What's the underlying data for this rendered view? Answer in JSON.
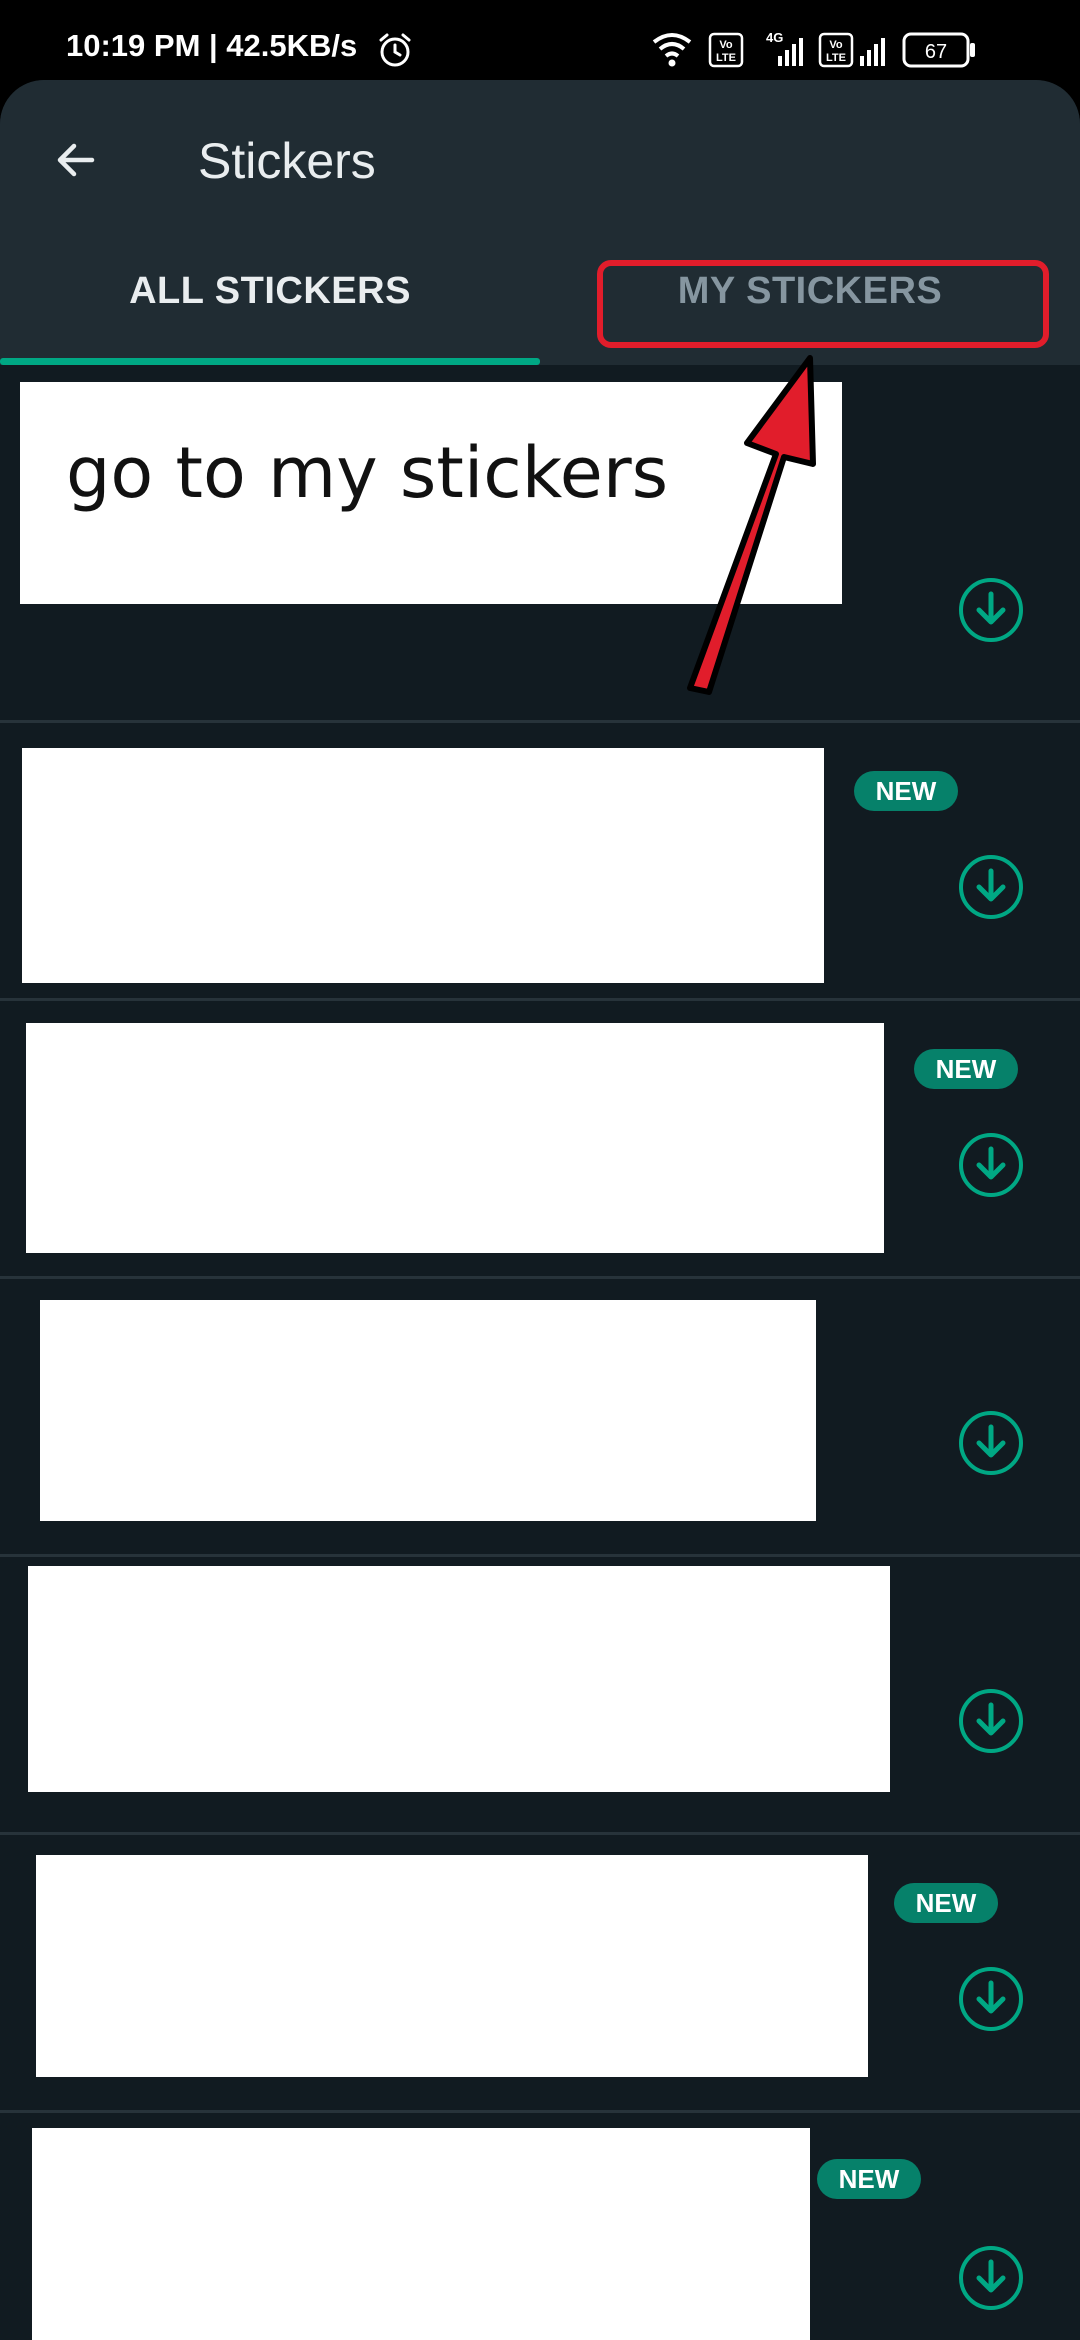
{
  "status_bar": {
    "time_and_speed": "10:19 PM | 42.5KB/s",
    "network_type": "4G",
    "volte_label_1": "Vo",
    "volte_label_2": "LTE",
    "battery_level": "67",
    "icons": [
      "alarm-icon",
      "wifi-icon",
      "volte-icon",
      "signal-icon",
      "battery-icon"
    ]
  },
  "header": {
    "title": "Stickers",
    "back_icon": "arrow-left-icon"
  },
  "tabs": [
    {
      "label": "ALL STICKERS",
      "selected": true
    },
    {
      "label": "MY STICKERS",
      "selected": false
    }
  ],
  "annotation": {
    "callout_text": "go to my stickers",
    "highlight_color": "#e11d2b"
  },
  "sticker_rows": [
    {
      "badge": ""
    },
    {
      "badge": "NEW"
    },
    {
      "badge": "NEW"
    },
    {
      "badge": ""
    },
    {
      "badge": ""
    },
    {
      "badge": "NEW"
    },
    {
      "badge": "NEW"
    }
  ],
  "colors": {
    "accent": "#00a884",
    "badge": "#06816a",
    "background": "#111b21",
    "toolbar": "#202c33"
  }
}
